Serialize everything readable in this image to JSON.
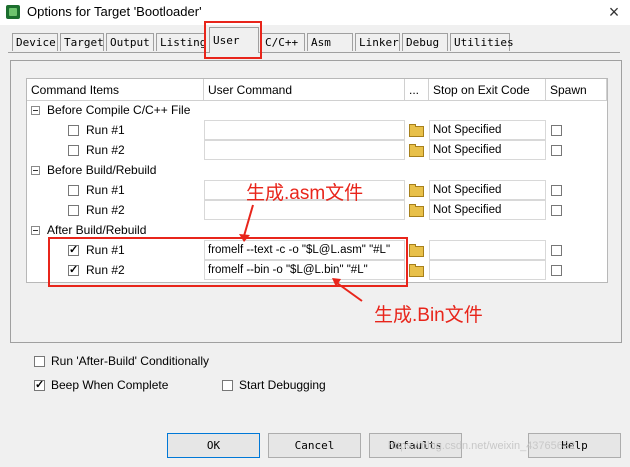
{
  "window": {
    "title": "Options for Target 'Bootloader'",
    "close_glyph": "×"
  },
  "tabs": [
    {
      "label": "Device"
    },
    {
      "label": "Target"
    },
    {
      "label": "Output"
    },
    {
      "label": "Listing"
    },
    {
      "label": "User",
      "active": true
    },
    {
      "label": "C/C++"
    },
    {
      "label": "Asm"
    },
    {
      "label": "Linker"
    },
    {
      "label": "Debug"
    },
    {
      "label": "Utilities"
    }
  ],
  "grid": {
    "headers": {
      "items": "Command Items",
      "command": "User Command",
      "browse": "...",
      "stop": "Stop on Exit Code",
      "spawn": "Spawn"
    },
    "groups": [
      {
        "label": "Before Compile C/C++ File",
        "rows": [
          {
            "label": "Run #1",
            "checked": false,
            "command": "",
            "stop": "Not Specified",
            "spawn": false
          },
          {
            "label": "Run #2",
            "checked": false,
            "command": "",
            "stop": "Not Specified",
            "spawn": false
          }
        ]
      },
      {
        "label": "Before Build/Rebuild",
        "rows": [
          {
            "label": "Run #1",
            "checked": false,
            "command": "",
            "stop": "Not Specified",
            "spawn": false
          },
          {
            "label": "Run #2",
            "checked": false,
            "command": "",
            "stop": "Not Specified",
            "spawn": false
          }
        ]
      },
      {
        "label": "After Build/Rebuild",
        "rows": [
          {
            "label": "Run #1",
            "checked": true,
            "command": "fromelf --text -c -o \"$L@L.asm\" \"#L\"",
            "stop": "",
            "spawn": false
          },
          {
            "label": "Run #2",
            "checked": true,
            "command": "fromelf --bin -o \"$L@L.bin\" \"#L\"",
            "stop": "",
            "spawn": false
          }
        ]
      }
    ]
  },
  "annotations": {
    "asm": "生成.asm文件",
    "bin": "生成.Bin文件"
  },
  "options": {
    "run_after_build": {
      "label": "Run 'After-Build' Conditionally",
      "checked": false
    },
    "beep": {
      "label": "Beep When Complete",
      "checked": true
    },
    "start_debugging": {
      "label": "Start Debugging",
      "checked": false
    }
  },
  "buttons": {
    "ok": "OK",
    "cancel": "Cancel",
    "defaults": "Defaults",
    "help": "Help"
  },
  "watermark": "https://blog.csdn.net/weixin_43765622",
  "colors": {
    "annotation_red": "#e8251b",
    "dialog_bg": "#f0f0f0",
    "folder_yellow": "#e8c04a"
  }
}
